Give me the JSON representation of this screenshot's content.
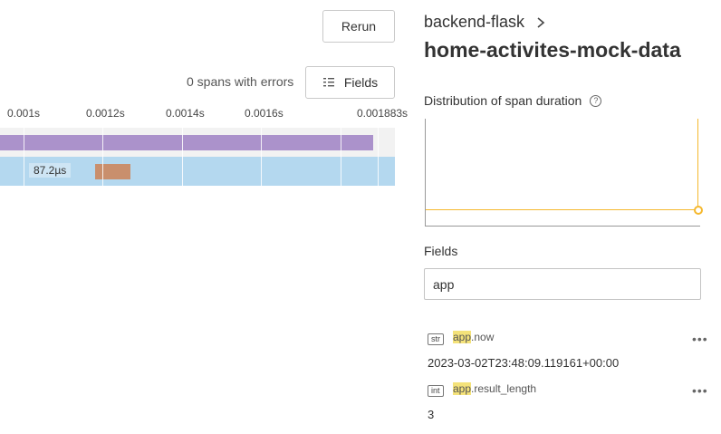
{
  "header": {
    "breadcrumb": "backend-flask",
    "title": "home-activites-mock-data"
  },
  "toolbar": {
    "rerun_label": "Rerun",
    "errors_text": "0 spans with errors",
    "fields_label": "Fields"
  },
  "timeline": {
    "ticks": [
      "0.001s",
      "0.0012s",
      "0.0014s",
      "0.0016s",
      "0.001883s"
    ],
    "span_label": "87.2µs",
    "colors": {
      "row1_bar": "#ab92cb",
      "row2_bg": "#b4d8ef",
      "small_span": "#c98f6d"
    }
  },
  "distribution": {
    "title": "Distribution of span duration",
    "accent": "#f5b82e"
  },
  "fields": {
    "heading": "Fields",
    "search_value": "app",
    "items": [
      {
        "type": "str",
        "prefix": "app",
        "suffix": ".now",
        "value": "2023-03-02T23:48:09.119161+00:00"
      },
      {
        "type": "int",
        "prefix": "app",
        "suffix": ".result_length",
        "value": "3"
      }
    ]
  }
}
